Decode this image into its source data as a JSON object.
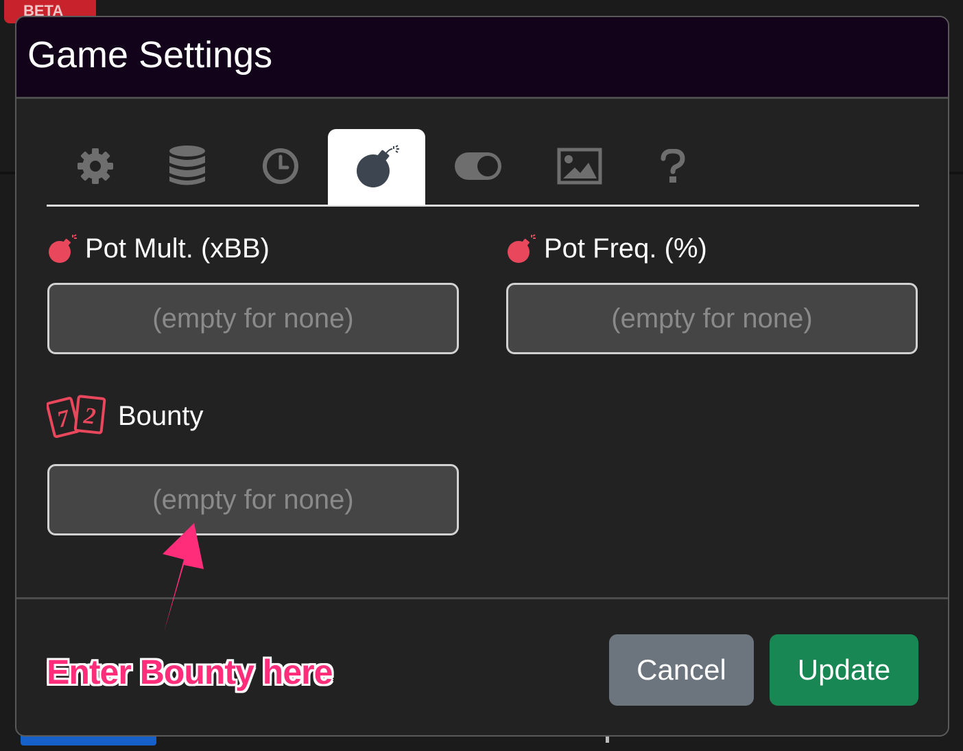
{
  "background": {
    "badge": "BETA"
  },
  "modal": {
    "title": "Game Settings",
    "tabs": [
      {
        "icon": "gear-icon",
        "active": false
      },
      {
        "icon": "database-icon",
        "active": false
      },
      {
        "icon": "clock-icon",
        "active": false
      },
      {
        "icon": "bomb-icon",
        "active": true
      },
      {
        "icon": "toggle-icon",
        "active": false
      },
      {
        "icon": "image-icon",
        "active": false
      },
      {
        "icon": "question-icon",
        "active": false
      }
    ],
    "fields": {
      "pot_mult": {
        "label": "Pot Mult. (xBB)",
        "placeholder": "(empty for none)",
        "value": ""
      },
      "pot_freq": {
        "label": "Pot Freq. (%)",
        "placeholder": "(empty for none)",
        "value": ""
      },
      "bounty": {
        "label": "Bounty",
        "placeholder": "(empty for none)",
        "value": "",
        "icon_cards": [
          "7",
          "2"
        ]
      }
    },
    "buttons": {
      "cancel": "Cancel",
      "update": "Update"
    }
  },
  "annotation": {
    "text": "Enter Bounty here"
  },
  "colors": {
    "header_bg": "#12021a",
    "modal_bg": "#222222",
    "accent_pink": "#ff2d7a",
    "bomb_red": "#e8475c",
    "cancel_bg": "#6c757d",
    "update_bg": "#198754"
  }
}
